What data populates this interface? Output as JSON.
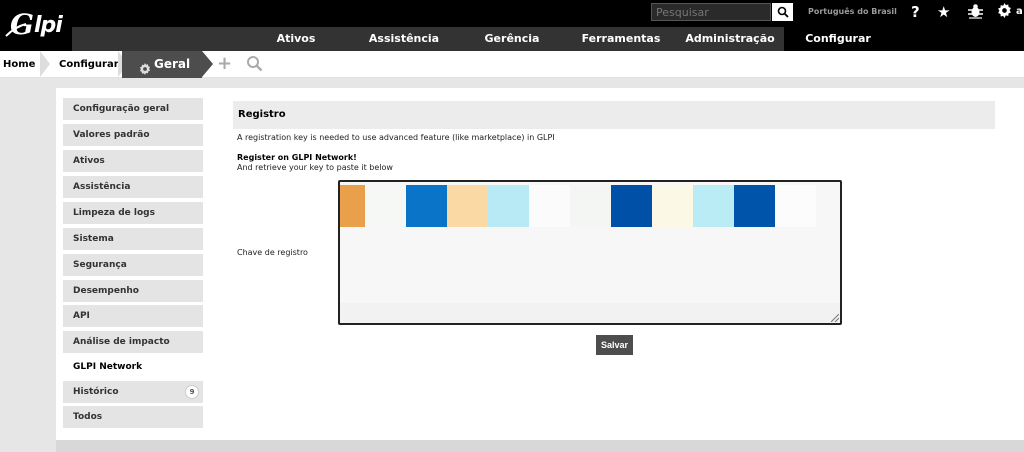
{
  "app": {
    "logo_text": "Glpi"
  },
  "topbar": {
    "search_placeholder": "Pesquisar",
    "language": "Português do Brasil",
    "icons": [
      "help-icon",
      "star-icon",
      "bug-icon",
      "gear-icon"
    ],
    "user_initial": "a"
  },
  "nav": {
    "items": [
      {
        "label": "Ativos"
      },
      {
        "label": "Assistência"
      },
      {
        "label": "Gerência"
      },
      {
        "label": "Ferramentas"
      },
      {
        "label": "Administração"
      },
      {
        "label": "Configurar",
        "active": true
      }
    ]
  },
  "breadcrumb": {
    "home": "Home",
    "configurar": "Configurar",
    "current": "Geral"
  },
  "sidebar": {
    "items": [
      {
        "label": "Configuração geral"
      },
      {
        "label": "Valores padrão"
      },
      {
        "label": "Ativos"
      },
      {
        "label": "Assistência"
      },
      {
        "label": "Limpeza de logs"
      },
      {
        "label": "Sistema"
      },
      {
        "label": "Segurança"
      },
      {
        "label": "Desempenho"
      },
      {
        "label": "API"
      },
      {
        "label": "Análise de impacto"
      },
      {
        "label": "GLPI Network",
        "active": true
      },
      {
        "label": "Histórico",
        "badge": "9"
      },
      {
        "label": "Todos"
      }
    ]
  },
  "main": {
    "title": "Registro",
    "info": "A registration key is needed to use advanced feature (like marketplace) in GLPI",
    "register_title": "Register on GLPI Network!",
    "register_sub": "And retrieve your key to paste it below",
    "key_label": "Chave de registro",
    "save_label": "Salvar",
    "key_swatches": [
      "#e8a04a",
      "#f6f8f6",
      "#0a74c8",
      "#fbd9a4",
      "#b8eaf5",
      "#fbfbfb",
      "#f4f6f4",
      "#0050a8",
      "#fbf9e6",
      "#b9ecf4",
      "#0055aa",
      "#fcfcfc"
    ]
  }
}
